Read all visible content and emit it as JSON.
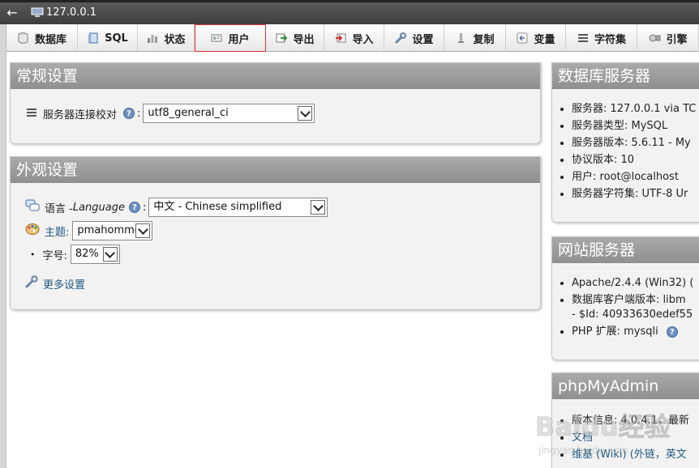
{
  "window": {
    "title": "127.0.0.1",
    "back_label": "←"
  },
  "tabs": [
    {
      "label": "数据库",
      "icon": "database-icon"
    },
    {
      "label": "SQL",
      "icon": "sql-icon"
    },
    {
      "label": "状态",
      "icon": "status-icon"
    },
    {
      "label": "用户",
      "icon": "users-icon"
    },
    {
      "label": "导出",
      "icon": "export-icon"
    },
    {
      "label": "导入",
      "icon": "import-icon"
    },
    {
      "label": "设置",
      "icon": "wrench-icon"
    },
    {
      "label": "复制",
      "icon": "replication-icon"
    },
    {
      "label": "变量",
      "icon": "variables-icon"
    },
    {
      "label": "字符集",
      "icon": "charset-icon"
    },
    {
      "label": "引擎",
      "icon": "engine-icon"
    }
  ],
  "general": {
    "title": "常规设置",
    "collation_label": "服务器连接校对",
    "collation_value": "utf8_general_ci"
  },
  "appearance": {
    "title": "外观设置",
    "language_label": "语言 - ",
    "language_label_en": "Language",
    "language_value": "中文 - Chinese simplified",
    "theme_label": "主题:",
    "theme_value": "pmahomme",
    "fontsize_label": "字号:",
    "fontsize_value": "82%",
    "more_settings": "更多设置"
  },
  "db_server": {
    "title": "数据库服务器",
    "items": [
      "服务器: 127.0.0.1 via TC",
      "服务器类型: MySQL",
      "服务器版本: 5.6.11 - My",
      "协议版本: 10",
      "用户: root@localhost",
      "服务器字符集: UTF-8 Ur"
    ]
  },
  "web_server": {
    "title": "网站服务器",
    "items": [
      "Apache/2.4.4 (Win32) (",
      "数据库客户端版本: libm",
      "- $Id: 40933630edef55",
      "PHP 扩展: mysqli"
    ]
  },
  "pma": {
    "title": "phpMyAdmin",
    "items": [
      "版本信息: 4.0.4.1，最新",
      "文档",
      "维基 (Wiki) (外链，英文"
    ]
  },
  "watermark": {
    "text": "Baidu经验",
    "sub": "jingyan.baidu.com"
  },
  "colors": {
    "header_bg": "#999999",
    "panel_bg": "#f2f2f2",
    "link": "#235a81",
    "highlight": "#dd3333"
  }
}
